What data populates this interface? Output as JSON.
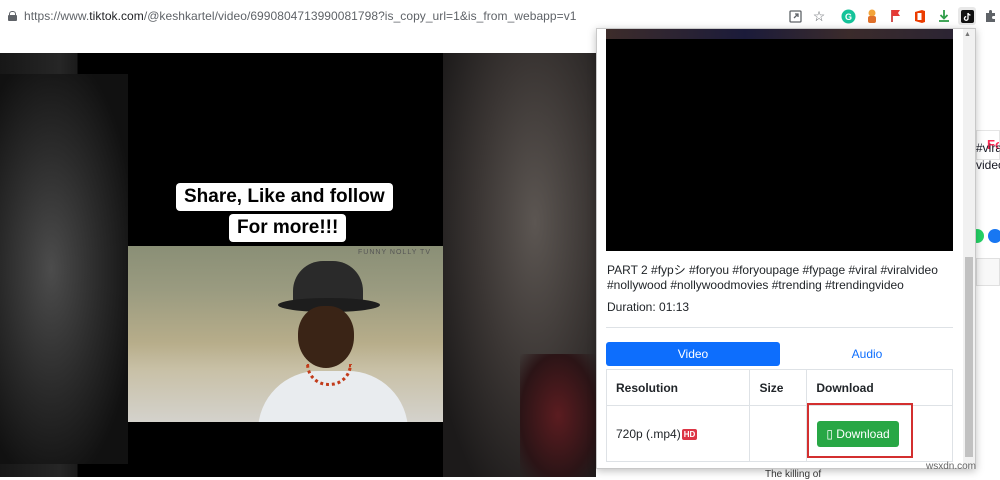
{
  "browser": {
    "url_prefix": "https://www.",
    "url_host": "tiktok.com",
    "url_path": "/@keshkartel/video/6990804713990081798?is_copy_url=1&is_from_webapp=v1",
    "icons": [
      "lock-icon",
      "open-in-app-icon",
      "bookmark-star-icon",
      "grammarly-extension-icon",
      "puppet-extension-icon",
      "flag-extension-icon",
      "office-extension-icon",
      "download-arrow-extension-icon",
      "tiktok-extension-icon",
      "extensions-puzzle-icon"
    ]
  },
  "video": {
    "caption_line1": "Share, Like and follow",
    "caption_line2": "For more!!!",
    "watermark": "FUNNY NOLLY TV"
  },
  "popup": {
    "description": "PART 2 #fypシ #foryou #foryoupage #fypage #viral #viralvideo #nollywood #nollywoodmovies #trending #trendingvideo",
    "duration": "Duration: 01:13",
    "tabs": {
      "video": "Video",
      "audio": "Audio"
    },
    "table": {
      "headers": [
        "Resolution",
        "Size",
        "Download"
      ],
      "rows": [
        {
          "resolution": "720p (.mp4)",
          "badge": "HD",
          "size": "",
          "button": "Download",
          "button_icon": "▯"
        }
      ]
    },
    "colors": {
      "primary": "#0d6efd",
      "success": "#28a745",
      "danger": "#dc3545",
      "highlight": "#d32f2f"
    }
  },
  "page_right": {
    "tab_partial": "Fo",
    "text1": "#vira",
    "text2": "video"
  },
  "footer": {
    "bottom_text": "The killing of",
    "corner_watermark": "wsxdn.com"
  }
}
